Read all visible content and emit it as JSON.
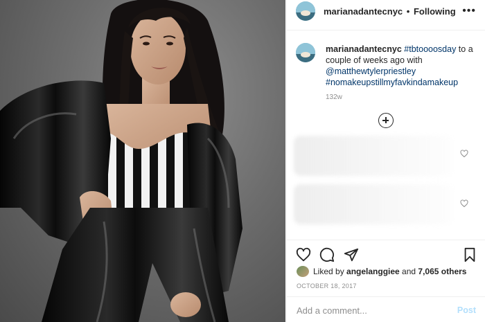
{
  "post": {
    "photo_alt": "photo",
    "header": {
      "username": "marianadantecnyc",
      "separator": "•",
      "follow_state": "Following",
      "more_icon": "more-options-icon"
    },
    "caption": {
      "username": "marianadantecnyc",
      "hashtag1": "#tbtoooosday",
      "text1": " to a couple of weeks ago with ",
      "mention": "@matthewtylerpriestley",
      "hashtag2": "#nomakeupstillmyfavkindamakeup",
      "time": "132w"
    },
    "likes": {
      "prefix": "Liked by ",
      "user": "angelanggiee",
      "middle": " and ",
      "count": "7,065 others"
    },
    "date": "OCTOBER 18, 2017",
    "comment": {
      "placeholder": "Add a comment...",
      "post_label": "Post"
    },
    "icons": [
      "heart-icon",
      "comment-icon",
      "share-icon",
      "bookmark-icon",
      "load-more-icon"
    ],
    "colors": {
      "link": "#003569",
      "muted": "#8e8e8e",
      "post_disabled": "#b2dffc",
      "border": "#efefef"
    }
  }
}
